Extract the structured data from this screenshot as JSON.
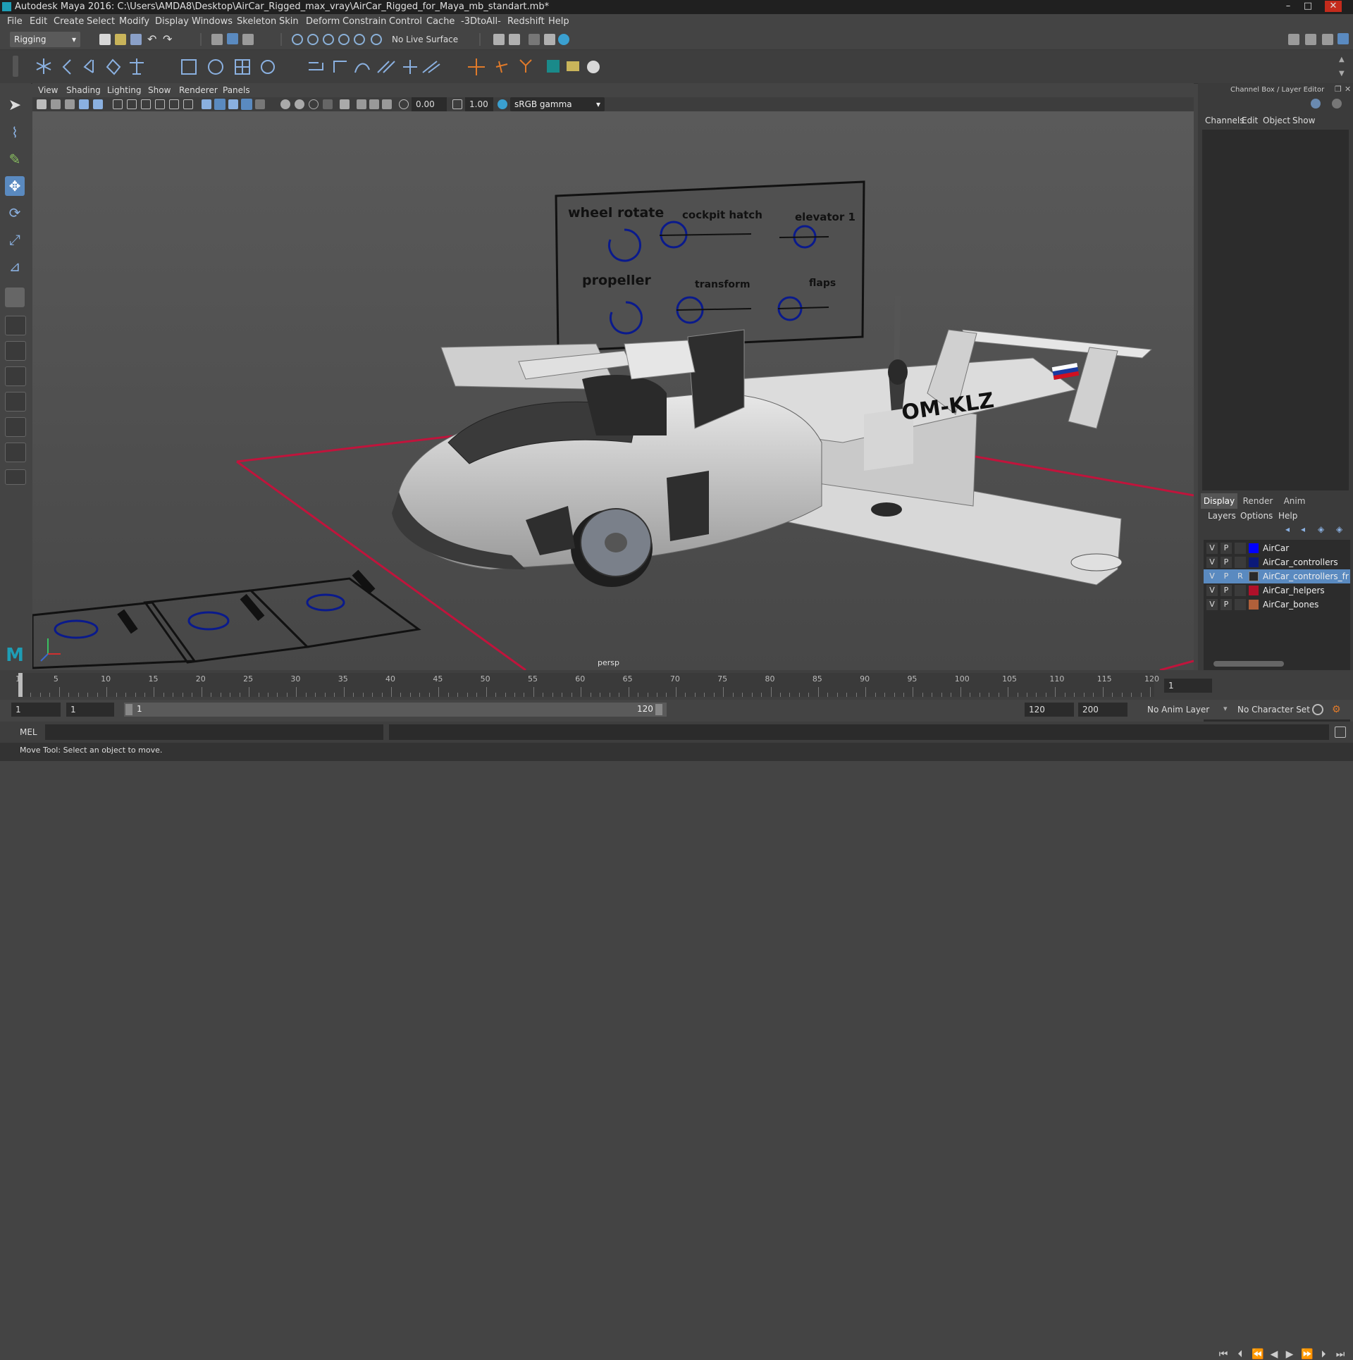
{
  "window": {
    "title": "Autodesk Maya 2016: C:\\Users\\AMDA8\\Desktop\\AirCar_Rigged_max_vray\\AirCar_Rigged_for_Maya_mb_standart.mb*",
    "minimize": "–",
    "maximize": "□",
    "close": "✕"
  },
  "menu": [
    "File",
    "Edit",
    "Create",
    "Select",
    "Modify",
    "Display",
    "Windows",
    "Skeleton",
    "Skin",
    "Deform",
    "Constrain",
    "Control",
    "Cache",
    "-3DtoAll-",
    "Redshift",
    "Help"
  ],
  "status_line": {
    "menu_set": "Rigging",
    "live_surface": "No Live Surface"
  },
  "panel_menu": [
    "View",
    "Shading",
    "Lighting",
    "Show",
    "Renderer",
    "Panels"
  ],
  "panel_toolbar": {
    "exposure": "0.00",
    "gamma": "1.00",
    "color_space": "sRGB gamma"
  },
  "viewport": {
    "camera_label": "persp",
    "tail_registration": "OM-KLZ",
    "control_panel_labels": [
      "wheel rotate",
      "cockpit hatch",
      "elevator 1",
      "propeller",
      "transform",
      "flaps"
    ],
    "colors": {
      "grid_red": "#c0143c",
      "controller_blue": "#0a1a8c"
    }
  },
  "channel_box": {
    "title": "Channel Box / Layer Editor",
    "menu": [
      "Channels",
      "Edit",
      "Object",
      "Show"
    ],
    "layer_tabs": [
      "Display",
      "Render",
      "Anim"
    ],
    "layer_menu": [
      "Layers",
      "Options",
      "Help"
    ],
    "layers": [
      {
        "v": "V",
        "p": "P",
        "r": "",
        "name": "AirCar",
        "color": "#0000ff",
        "selected": false
      },
      {
        "v": "V",
        "p": "P",
        "r": "",
        "name": "AirCar_controllers",
        "color": "#0b1a7a",
        "selected": false
      },
      {
        "v": "V",
        "p": "P",
        "r": "R",
        "name": "AirCar_controllers_freeze",
        "color": "#2a2a2a",
        "selected": true
      },
      {
        "v": "V",
        "p": "P",
        "r": "",
        "name": "AirCar_helpers",
        "color": "#b0102a",
        "selected": false
      },
      {
        "v": "V",
        "p": "P",
        "r": "",
        "name": "AirCar_bones",
        "color": "#b0603a",
        "selected": false
      }
    ]
  },
  "timeline": {
    "ticks": [
      "1",
      "5",
      "10",
      "15",
      "20",
      "25",
      "30",
      "35",
      "40",
      "45",
      "50",
      "55",
      "60",
      "65",
      "70",
      "75",
      "80",
      "85",
      "90",
      "95",
      "100",
      "105",
      "110",
      "115",
      "120"
    ],
    "current_frame": "1"
  },
  "range_slider": {
    "start": "1",
    "playback_start": "1",
    "slider_start": "1",
    "slider_end": "120",
    "playback_end": "120",
    "end": "200",
    "anim_layer": "No Anim Layer",
    "character_set": "No Character Set"
  },
  "command_line": {
    "language": "MEL"
  },
  "help_line": {
    "text": "Move Tool: Select an object to move."
  }
}
